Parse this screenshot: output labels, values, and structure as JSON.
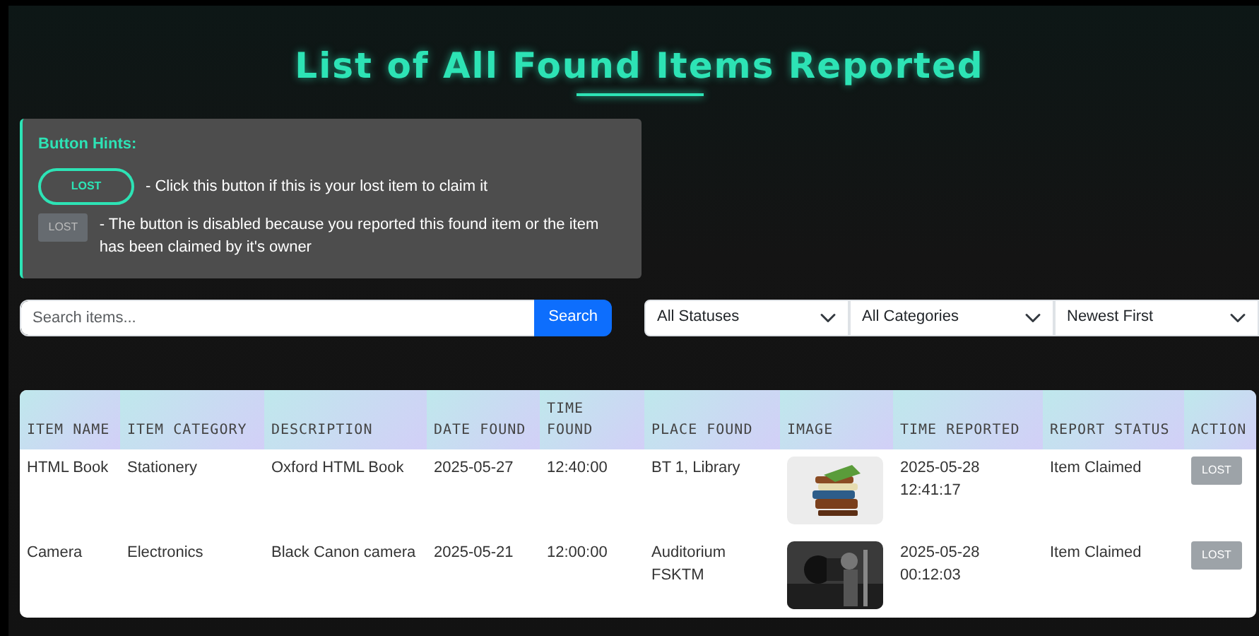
{
  "title": "List of All Found Items Reported",
  "hints": {
    "heading": "Button Hints:",
    "items": [
      {
        "button": "LOST",
        "disabled": false,
        "text": "- Click this button if this is your lost item to claim it"
      },
      {
        "button": "LOST",
        "disabled": true,
        "text": "- The button is disabled because you reported this found item or the item has been claimed by it's owner"
      }
    ]
  },
  "search": {
    "placeholder": "Search items...",
    "button": "Search"
  },
  "filters": [
    "All Statuses",
    "All Categories",
    "Newest First"
  ],
  "table": {
    "columns": [
      "ITEM NAME",
      "ITEM CATEGORY",
      "DESCRIPTION",
      "DATE FOUND",
      "TIME FOUND",
      "PLACE FOUND",
      "IMAGE",
      "TIME REPORTED",
      "REPORT STATUS",
      "ACTION"
    ],
    "rows": [
      {
        "item_name": "HTML Book",
        "item_category": "Stationery",
        "description": "Oxford HTML Book",
        "date_found": "2025-05-27",
        "time_found": "12:40:00",
        "place_found": "BT 1, Library",
        "time_reported": "2025-05-28 12:41:17",
        "report_status": "Item Claimed",
        "action": {
          "label": "LOST",
          "disabled": true
        }
      },
      {
        "item_name": "Camera",
        "item_category": "Electronics",
        "description": "Black Canon camera",
        "date_found": "2025-05-21",
        "time_found": "12:00:00",
        "place_found": "Auditorium FSKTM",
        "time_reported": "2025-05-28 00:12:03",
        "report_status": "Item Claimed",
        "action": {
          "label": "LOST",
          "disabled": true
        }
      }
    ]
  }
}
